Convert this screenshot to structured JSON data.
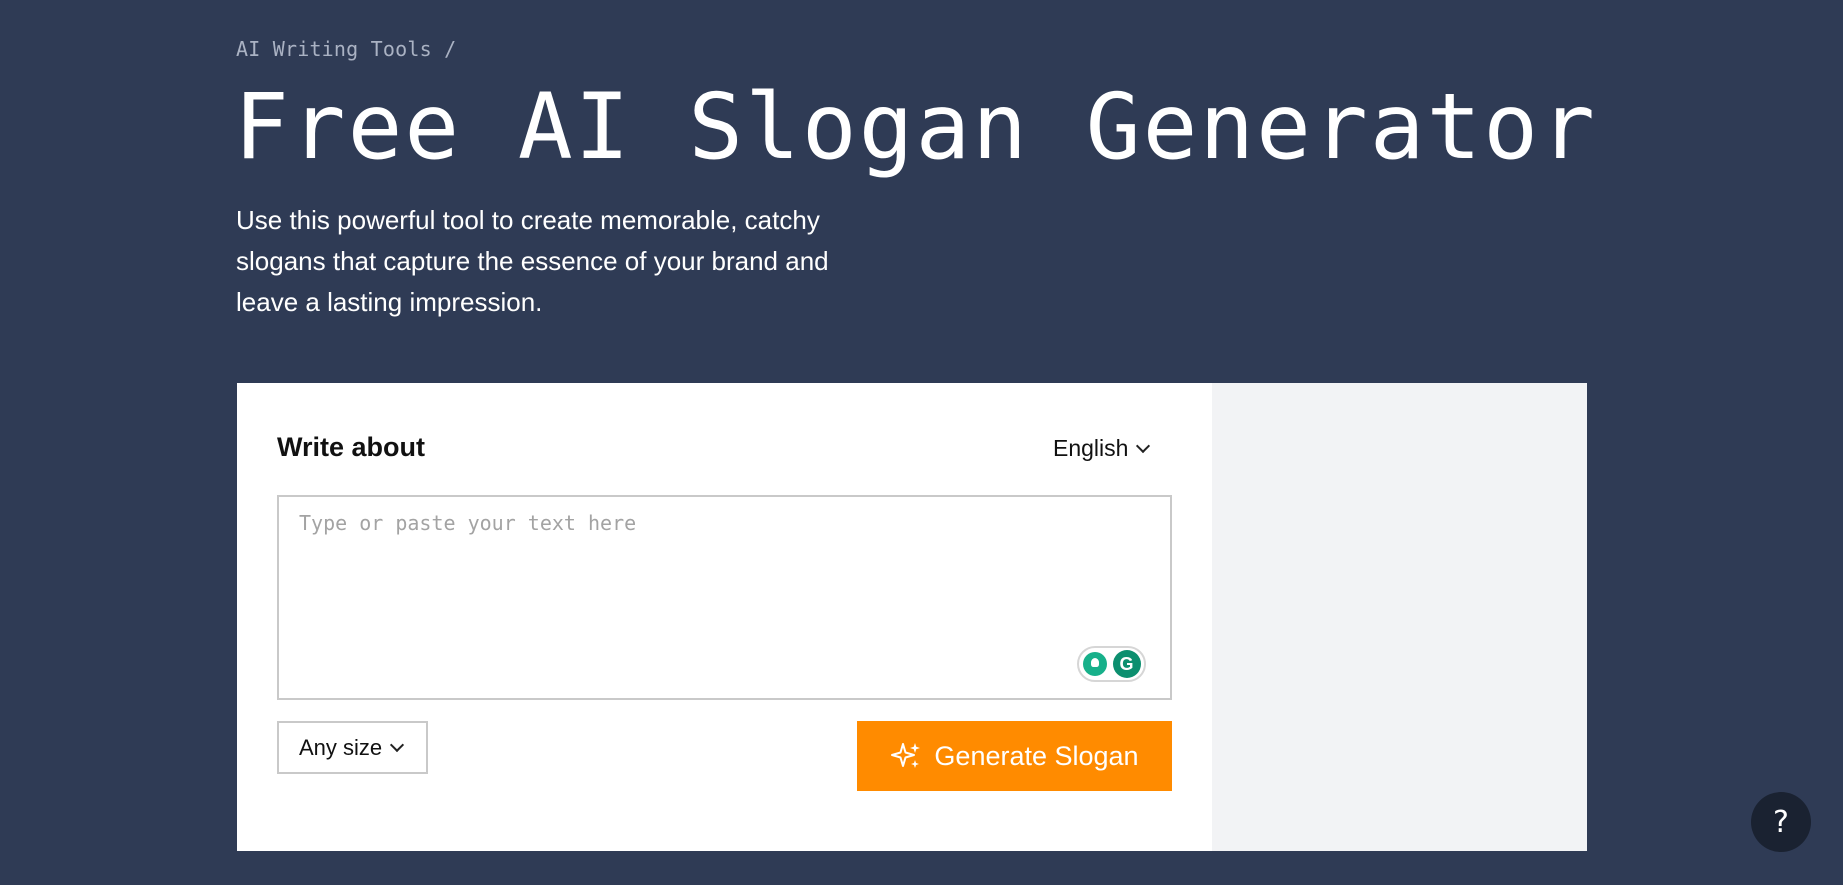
{
  "breadcrumb": {
    "label": "AI Writing Tools /"
  },
  "hero": {
    "title": "Free AI Slogan Generator",
    "description": "Use this powerful tool to create memorable, catchy slogans that capture the essence of your brand and leave a lasting impression."
  },
  "tool": {
    "write_label": "Write about",
    "language": {
      "selected": "English",
      "icon": "chevron-down-icon"
    },
    "input": {
      "placeholder": "Type or paste your text here",
      "value": ""
    },
    "grammarly": {
      "icons": [
        "lightbulb-icon",
        "grammarly-icon"
      ],
      "logo_letter": "G"
    },
    "size_select": {
      "selected": "Any size",
      "icon": "chevron-down-icon"
    },
    "generate_button": {
      "label": "Generate Slogan",
      "icon": "sparkle-icon",
      "color": "#ff8b00"
    }
  },
  "help": {
    "label": "?"
  },
  "colors": {
    "background": "#2f3b55",
    "card": "#ffffff",
    "side_panel": "#f2f3f5",
    "accent": "#ff8b00"
  }
}
